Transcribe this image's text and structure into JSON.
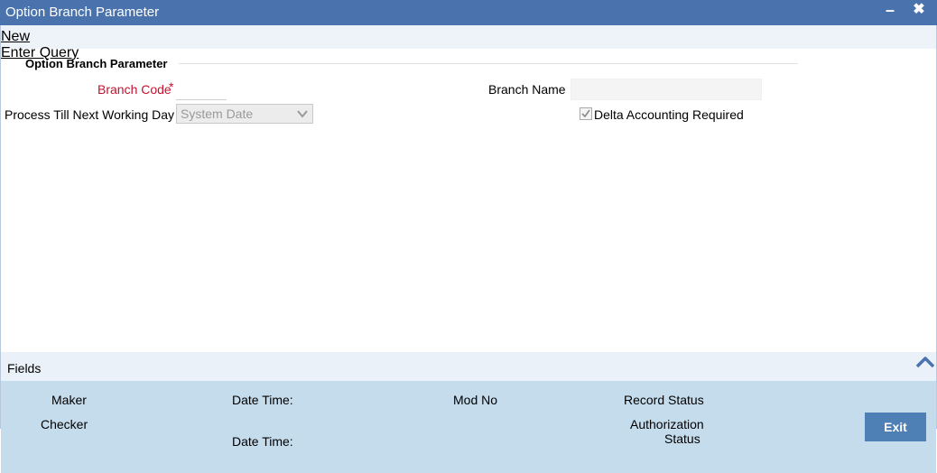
{
  "window": {
    "title": "Option Branch Parameter",
    "minimize_label": "–",
    "close_label": "✖"
  },
  "toolbar": {
    "new_label": "New",
    "enter_query_label": "Enter Query"
  },
  "section": {
    "title": "Option Branch Parameter"
  },
  "form": {
    "branch_code_label": "Branch Code",
    "required_mark": "*",
    "branch_code_value": "",
    "branch_name_label": "Branch Name",
    "branch_name_value": "",
    "process_label": "Process Till Next Working Day",
    "process_value": "System Date",
    "delta_label": "Delta Accounting Required",
    "delta_checked": true
  },
  "fields_bar": {
    "label": "Fields"
  },
  "audit": {
    "maker_label": "Maker",
    "checker_label": "Checker",
    "date_time_label_1": "Date Time:",
    "date_time_label_2": "Date Time:",
    "mod_no_label": "Mod No",
    "record_status_label": "Record Status",
    "authorization_label": "Authorization",
    "status_label": "Status",
    "exit_label": "Exit"
  },
  "colors": {
    "titlebar": "#4a73ad",
    "audit_bg": "#c5dced",
    "required": "#c8102e",
    "exit_button": "#4e7fb5"
  }
}
